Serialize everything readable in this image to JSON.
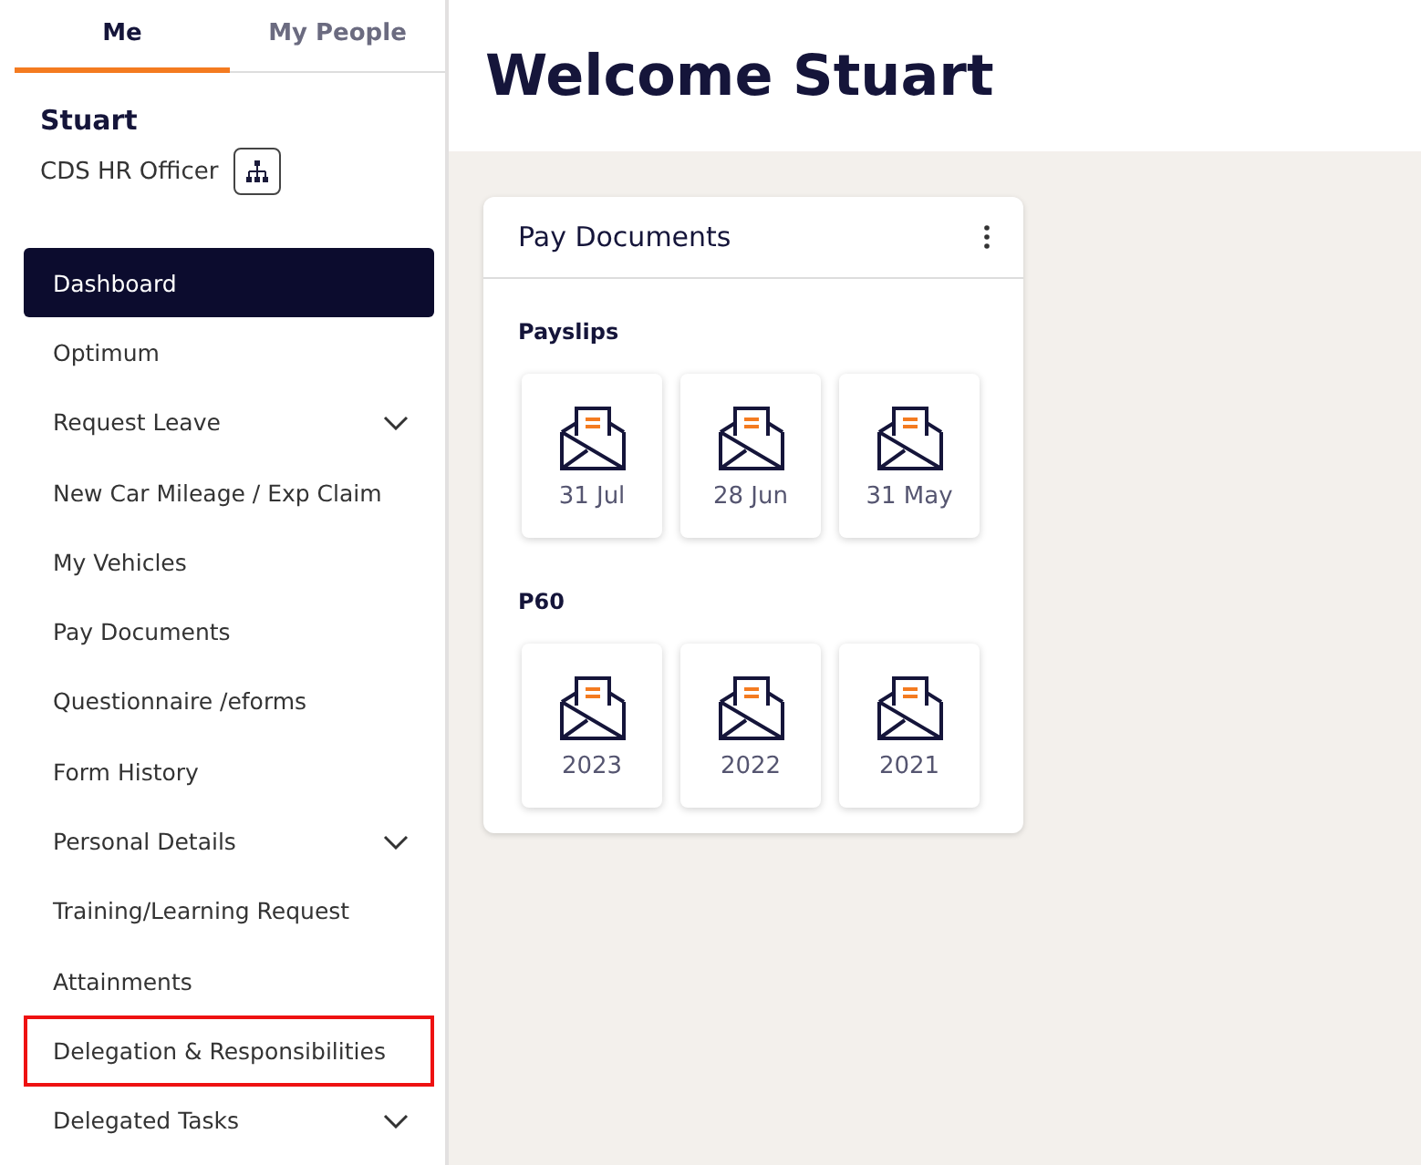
{
  "tabs": [
    {
      "label": "Me",
      "selected": true
    },
    {
      "label": "My People",
      "selected": false
    }
  ],
  "user": {
    "name": "Stuart",
    "role": "CDS HR Officer"
  },
  "nav": [
    {
      "label": "Dashboard",
      "selected": true,
      "expandable": false,
      "highlighted": false
    },
    {
      "label": "Optimum",
      "selected": false,
      "expandable": false,
      "highlighted": false
    },
    {
      "label": "Request Leave",
      "selected": false,
      "expandable": true,
      "highlighted": false
    },
    {
      "label": "New Car Mileage / Exp Claim",
      "selected": false,
      "expandable": false,
      "highlighted": false
    },
    {
      "label": "My Vehicles",
      "selected": false,
      "expandable": false,
      "highlighted": false
    },
    {
      "label": "Pay Documents",
      "selected": false,
      "expandable": false,
      "highlighted": false
    },
    {
      "label": "Questionnaire /eforms",
      "selected": false,
      "expandable": false,
      "highlighted": false
    },
    {
      "label": "Form History",
      "selected": false,
      "expandable": false,
      "highlighted": false
    },
    {
      "label": "Personal Details",
      "selected": false,
      "expandable": true,
      "highlighted": false
    },
    {
      "label": "Training/Learning Request",
      "selected": false,
      "expandable": false,
      "highlighted": false
    },
    {
      "label": "Attainments",
      "selected": false,
      "expandable": false,
      "highlighted": false
    },
    {
      "label": "Delegation & Responsibilities",
      "selected": false,
      "expandable": false,
      "highlighted": true
    },
    {
      "label": "Delegated Tasks",
      "selected": false,
      "expandable": true,
      "highlighted": false
    }
  ],
  "page": {
    "title": "Welcome Stuart"
  },
  "card": {
    "title": "Pay Documents",
    "sections": [
      {
        "heading": "Payslips",
        "documents": [
          "31 Jul",
          "28 Jun",
          "31 May"
        ]
      },
      {
        "heading": "P60",
        "documents": [
          "2023",
          "2022",
          "2021"
        ]
      }
    ]
  }
}
